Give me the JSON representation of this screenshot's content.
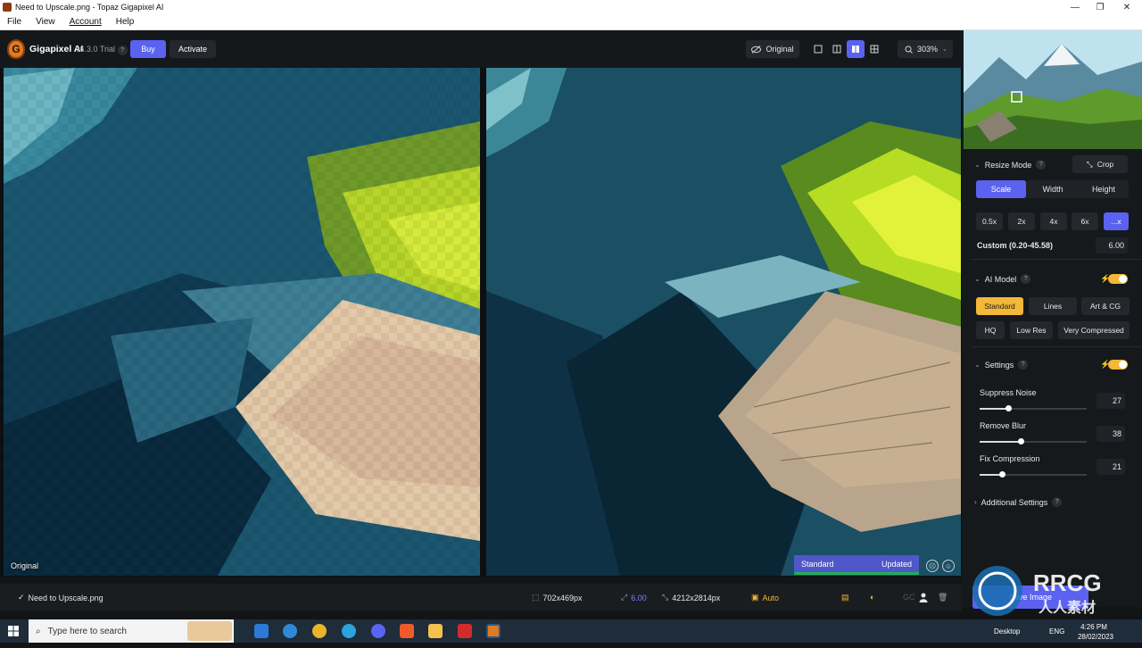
{
  "window": {
    "title": "Need to Upscale.png - Topaz Gigapixel AI"
  },
  "menu": [
    "File",
    "View",
    "Account",
    "Help"
  ],
  "header": {
    "app_name": "Gigapixel AI",
    "version": "v6.3.0 Trial",
    "help": "?",
    "buy": "Buy",
    "activate": "Activate",
    "original": "Original",
    "zoom": "303%",
    "logo_letter": "G"
  },
  "preview": {
    "original_label": "Original",
    "model_name": "Standard",
    "model_status": "Updated"
  },
  "panel": {
    "resize_mode": {
      "title": "Resize Mode",
      "crop": "Crop",
      "tabs": [
        "Scale",
        "Width",
        "Height"
      ],
      "presets": [
        "0.5x",
        "2x",
        "4x",
        "6x",
        "...x"
      ],
      "custom_label": "Custom (0.20-45.58)",
      "custom_value": "6.00"
    },
    "ai_model": {
      "title": "AI Model",
      "models": [
        "Standard",
        "Lines",
        "Art & CG",
        "HQ",
        "Low Res",
        "Very Compressed"
      ]
    },
    "settings": {
      "title": "Settings",
      "items": [
        {
          "label": "Suppress Noise",
          "value": "27",
          "level": 0.27
        },
        {
          "label": "Remove Blur",
          "value": "38",
          "level": 0.38
        },
        {
          "label": "Fix Compression",
          "value": "21",
          "level": 0.21
        }
      ]
    },
    "additional": {
      "title": "Additional Settings"
    }
  },
  "statusbar": {
    "filename": "Need to Upscale.png",
    "input_size": "702x469px",
    "scale": "6.00",
    "output_size": "4212x2814px",
    "auto": "Auto",
    "gc": "GC"
  },
  "save": {
    "label": "Save Image"
  },
  "taskbar": {
    "search_placeholder": "Type here to search",
    "desktop": "Desktop",
    "lang": "ENG",
    "time": "4:26 PM",
    "date": "28/02/2023"
  },
  "watermark": {
    "text": "RRCG",
    "sub": "人人素材"
  },
  "colors": {
    "accent": "#5b62f0",
    "highlight": "#f3b73a",
    "panel": "#16191c"
  }
}
